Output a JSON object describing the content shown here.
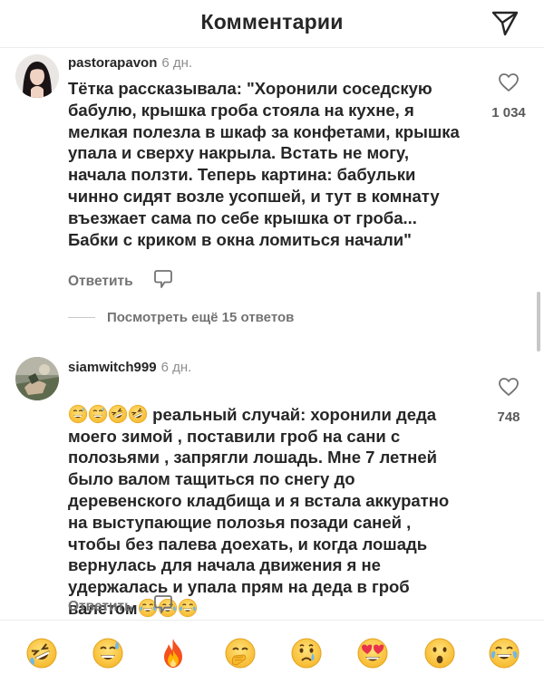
{
  "header": {
    "title": "Комментарии"
  },
  "comments": [
    {
      "username": "pastorapavon",
      "time": "6 дн.",
      "text": "Тётка рассказывала: \"Хоронили соседскую бабулю, крышка гроба стояла на кухне, я мелкая полезла в шкаф за конфетами, крышка упала и сверху накрыла. Встать не могу, начала ползти. Теперь картина: бабульки чинно сидят возле усопшей, и тут в комнату въезжает сама по себе крышка от гроба... Бабки с криком в окна ломиться начали\"",
      "likes": "1 034",
      "reply_label": "Ответить",
      "view_replies": "Посмотреть ещё 15 ответов"
    },
    {
      "username": "siamwitch999",
      "time": "6 дн.",
      "text": "реальный случай: хоронили деда моего зимой , поставили гроб на сани с полозьями , запрягли лошадь. Мне 7 летней было валом тащиться по снегу до деревенского кладбища и я встала аккуратно на выступающие полозья позади саней , чтобы без палева доехать, и когда лошадь вернулась для начала движения я не удержалась и упала прям на деда в гроб валетом",
      "likes": "748",
      "reply_label": "Ответить"
    }
  ],
  "emoji_bar": [
    "rolling-laughing",
    "sweat-smile",
    "fire",
    "hand-over-mouth",
    "crying",
    "heart-eyes",
    "surprised",
    "tears-of-joy"
  ]
}
